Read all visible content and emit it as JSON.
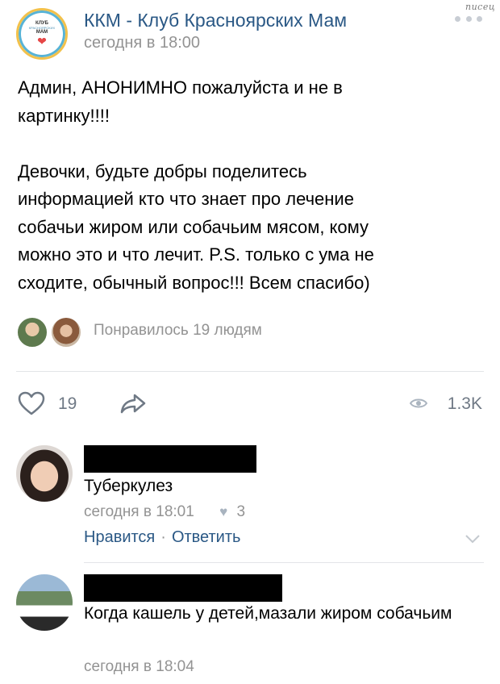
{
  "watermark": "писец",
  "post": {
    "group_name": "ККМ - Клуб Красноярских Мам",
    "time": "сегодня в 18:00",
    "avatar_logo": {
      "line1": "КЛУБ",
      "line2": "КРАСНОЯРСКИХ",
      "line3": "МАМ"
    },
    "text_lines": [
      "Админ, АНОНИМНО пожалуйста и не в",
      "картинку!!!!",
      "",
      "Девочки, будьте добры поделитесь",
      "информацией кто что знает про лечение",
      "собачьи жиром или собачьим мясом, кому",
      "можно это и что лечит. P.S. только с ума не",
      "сходите, обычный вопрос!!! Всем спасибо)"
    ],
    "liked_by_text": "Понравилось 19 людям",
    "likes_count": "19",
    "views_count": "1.3K",
    "icons": {
      "more": "more-dots-icon",
      "like": "heart-icon",
      "share": "share-arrow-icon",
      "views": "eye-icon"
    }
  },
  "comments": [
    {
      "text": "Туберкулез",
      "time": "сегодня в 18:01",
      "likes": "3",
      "like_label": "Нравится",
      "reply_label": "Ответить",
      "separator": "·"
    },
    {
      "text": "Когда кашель у детей,мазали жиром собачьим",
      "time": "сегодня в 18:04"
    }
  ],
  "colors": {
    "link": "#2a5885",
    "muted": "#939393",
    "icon": "#6f7985",
    "divider": "#e3e5e8"
  }
}
